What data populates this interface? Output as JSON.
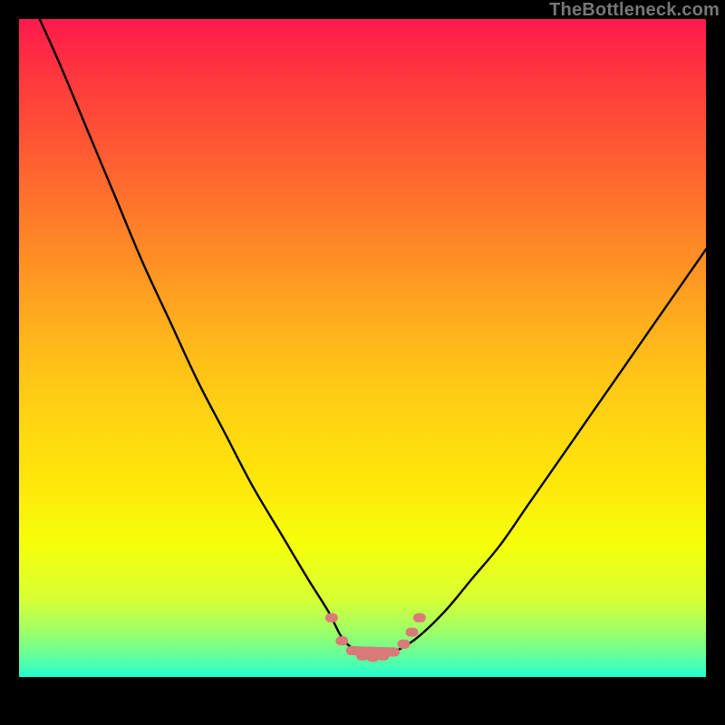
{
  "watermark": "TheBottleneck.com",
  "colors": {
    "frame": "#000000",
    "curve": "#000000",
    "marker": "#d97a78",
    "gradient_top": "#ff1a4d",
    "gradient_bottom": "#22ffd0"
  },
  "chart_data": {
    "type": "line",
    "title": "",
    "xlabel": "",
    "ylabel": "",
    "xlim": [
      0,
      100
    ],
    "ylim": [
      0,
      100
    ],
    "curve": {
      "name": "bottleneck-curve",
      "x": [
        3,
        6,
        10,
        14,
        18,
        22,
        26,
        30,
        34,
        38,
        42,
        45,
        47,
        49,
        51,
        53,
        55,
        58,
        62,
        66,
        70,
        74,
        78,
        82,
        86,
        90,
        94,
        98,
        100
      ],
      "y": [
        100,
        93,
        83,
        73,
        63,
        54,
        45,
        37,
        29,
        22,
        15,
        10,
        6,
        4,
        3,
        3,
        4,
        6,
        10,
        15,
        20,
        26,
        32,
        38,
        44,
        50,
        56,
        62,
        65
      ]
    },
    "markers": {
      "name": "trough-markers",
      "x": [
        45.5,
        47.0,
        48.5,
        50.0,
        51.5,
        53.0,
        54.5,
        56.0,
        57.2,
        58.3
      ],
      "y": [
        9.0,
        5.5,
        4.0,
        3.2,
        3.0,
        3.2,
        3.8,
        5.0,
        6.8,
        9.0
      ]
    }
  }
}
